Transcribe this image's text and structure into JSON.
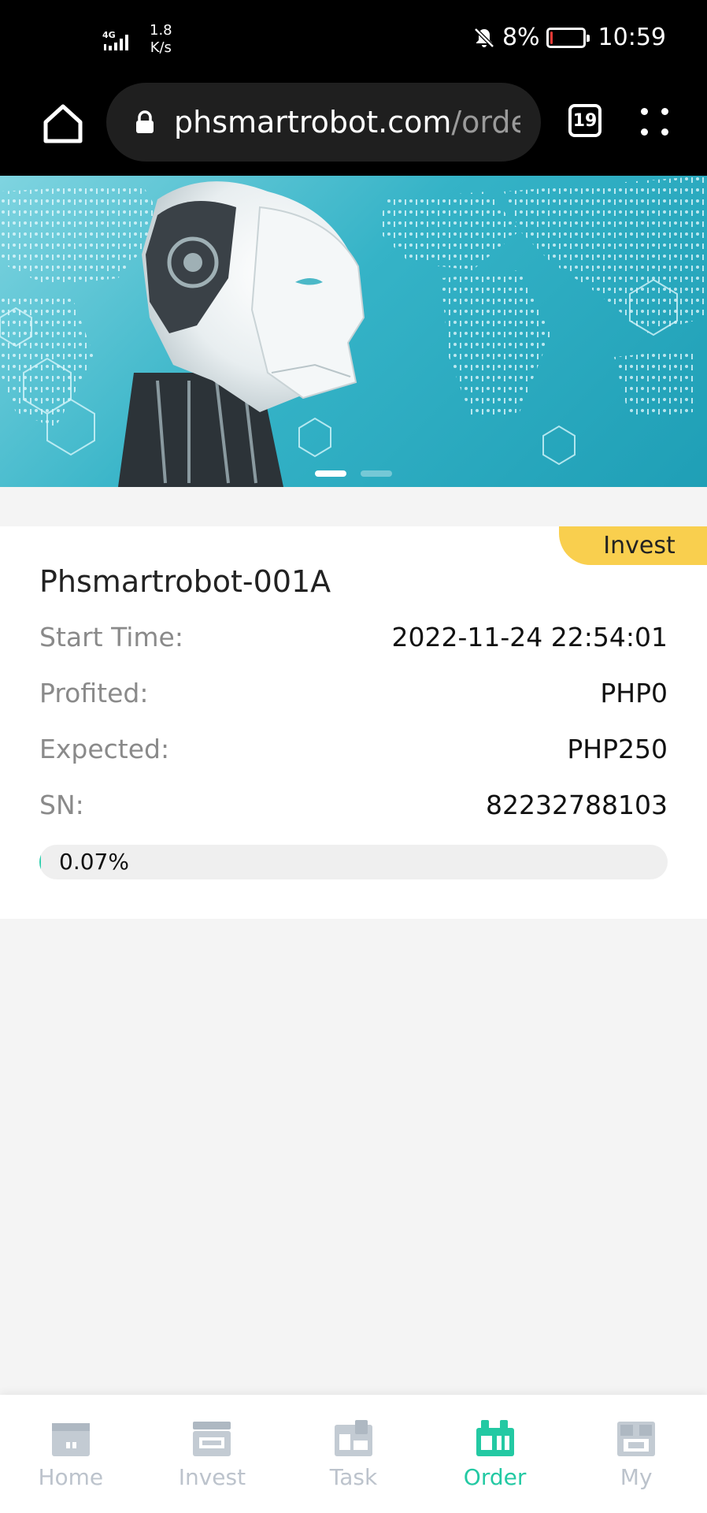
{
  "status_bar": {
    "network": "4G",
    "speed_value": "1.8",
    "speed_unit": "K/s",
    "battery": "8%",
    "time": "10:59",
    "battery_level": 0.08,
    "icons": [
      "signal-icon",
      "mute-icon",
      "battery-icon"
    ]
  },
  "browser": {
    "url_host": "phsmartrobot.com",
    "url_path": "/order",
    "tab_count": "19"
  },
  "banner": {
    "slides": 2,
    "active_slide": 1
  },
  "order": {
    "badge": "Invest",
    "title": "Phsmartrobot-001A",
    "rows": [
      {
        "label": "Start Time:",
        "value": "2022-11-24 22:54:01"
      },
      {
        "label": "Profited:",
        "value": "PHP0"
      },
      {
        "label": "Expected:",
        "value": "PHP250"
      },
      {
        "label": "SN:",
        "value": "82232788103"
      }
    ],
    "progress_text": "0.07%",
    "progress_value": 0.07
  },
  "nav": {
    "items": [
      {
        "label": "Home",
        "icon": "home-icon"
      },
      {
        "label": "Invest",
        "icon": "invest-icon"
      },
      {
        "label": "Task",
        "icon": "task-icon"
      },
      {
        "label": "Order",
        "icon": "order-icon"
      },
      {
        "label": "My",
        "icon": "my-icon"
      }
    ],
    "active": "Order"
  },
  "colors": {
    "accent": "#23c9a3",
    "badge": "#f9cf4e",
    "inactive_nav": "#bcc3cc"
  }
}
